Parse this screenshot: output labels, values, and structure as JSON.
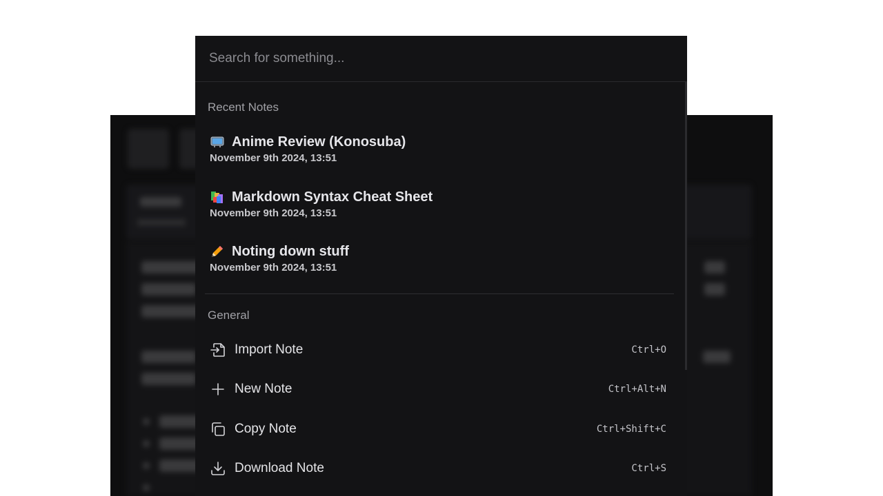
{
  "search": {
    "placeholder": "Search for something..."
  },
  "recent": {
    "label": "Recent Notes",
    "items": [
      {
        "title": "Anime Review (Konosuba)",
        "date": "November 9th 2024, 13:51",
        "icon": "tv-icon"
      },
      {
        "title": "Markdown Syntax Cheat Sheet",
        "date": "November 9th 2024, 13:51",
        "icon": "books-icon"
      },
      {
        "title": "Noting down stuff",
        "date": "November 9th 2024, 13:51",
        "icon": "pencil-icon"
      }
    ]
  },
  "general": {
    "label": "General",
    "items": [
      {
        "label": "Import Note",
        "shortcut": "Ctrl+O",
        "icon": "import-icon"
      },
      {
        "label": "New Note",
        "shortcut": "Ctrl+Alt+N",
        "icon": "plus-icon"
      },
      {
        "label": "Copy Note",
        "shortcut": "Ctrl+Shift+C",
        "icon": "copy-icon"
      },
      {
        "label": "Download Note",
        "shortcut": "Ctrl+S",
        "icon": "download-icon"
      }
    ]
  },
  "colors": {
    "palette_bg": "#131315",
    "backdrop": "#0e0e0f",
    "text": "#e4e4e7"
  }
}
